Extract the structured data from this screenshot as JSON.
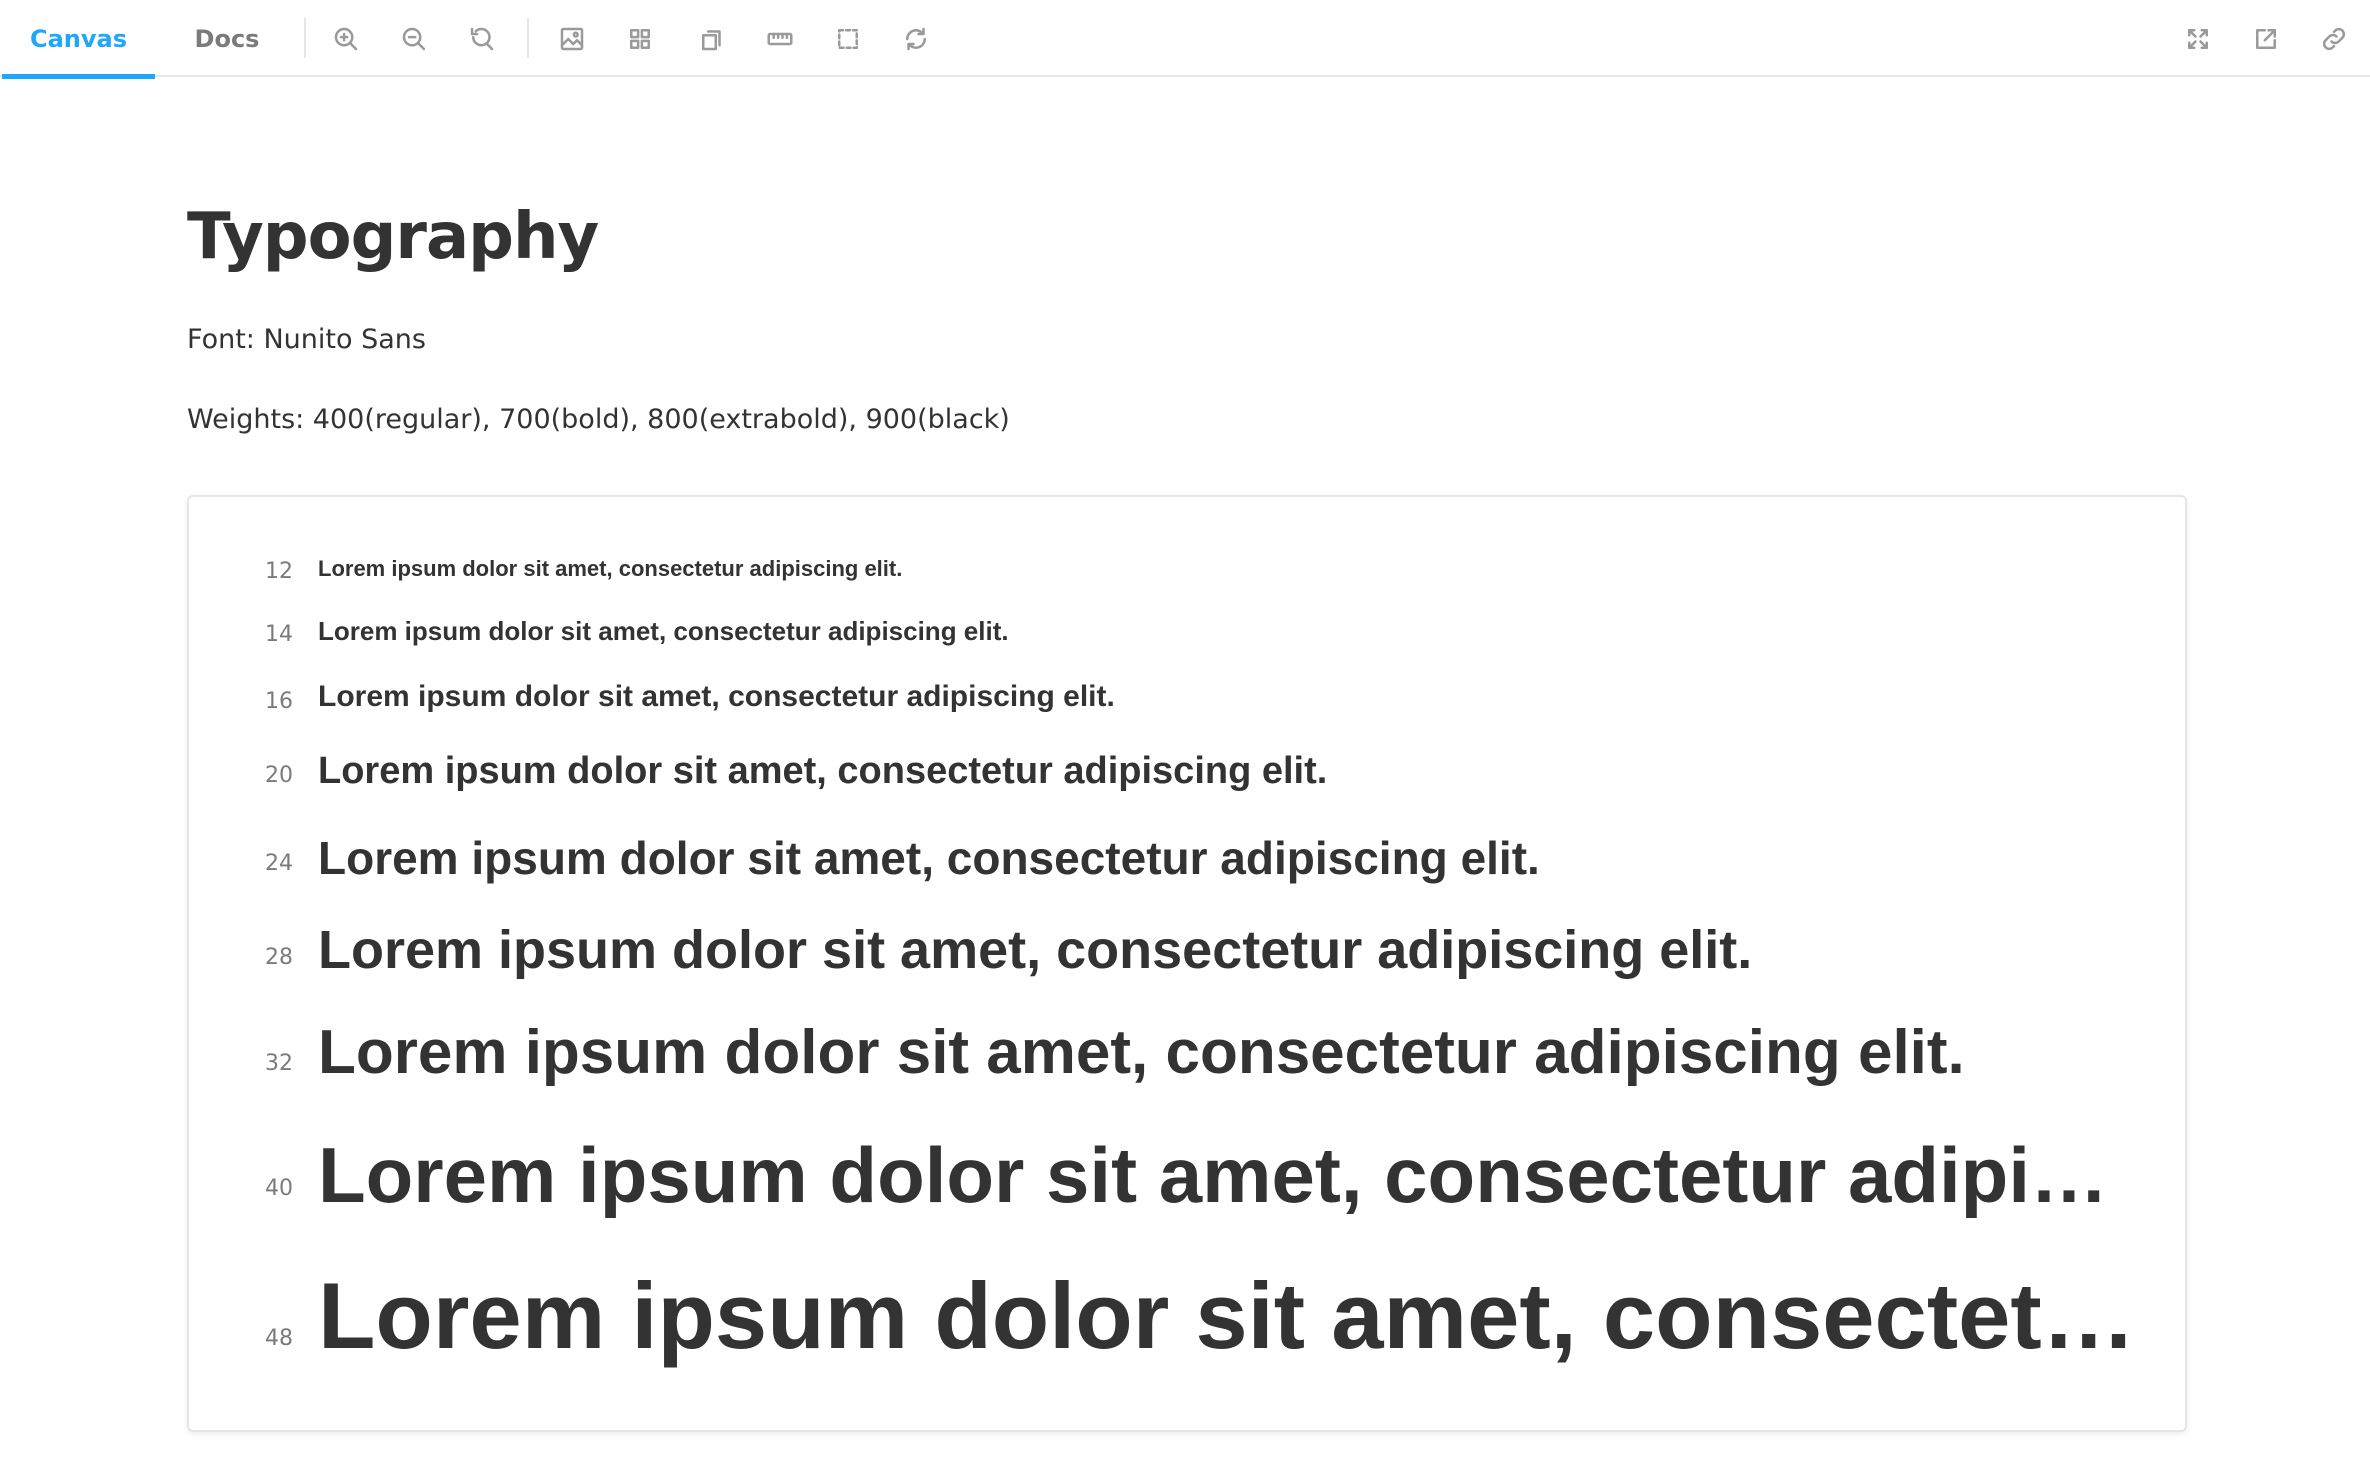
{
  "toolbar": {
    "tabs": [
      {
        "label": "Canvas",
        "active": true
      },
      {
        "label": "Docs",
        "active": false
      }
    ],
    "tools": [
      "zoom-in-icon",
      "zoom-out-icon",
      "reset-zoom-icon",
      "background-icon",
      "grid-icon",
      "viewport-icon",
      "measure-icon",
      "outline-icon",
      "remount-icon"
    ],
    "right_tools": [
      "fullscreen-icon",
      "open-new-tab-icon",
      "copy-link-icon"
    ],
    "accent_color": "#1ea7fd"
  },
  "page": {
    "title": "Typography",
    "font_line": "Font: Nunito Sans",
    "weights_line": "Weights: 400(regular), 700(bold), 800(extrabold), 900(black)"
  },
  "samples": [
    {
      "size": "12",
      "text": "Lorem ipsum dolor sit amet, consectetur adipiscing elit."
    },
    {
      "size": "14",
      "text": "Lorem ipsum dolor sit amet, consectetur adipiscing elit."
    },
    {
      "size": "16",
      "text": "Lorem ipsum dolor sit amet, consectetur adipiscing elit."
    },
    {
      "size": "20",
      "text": "Lorem ipsum dolor sit amet, consectetur adipiscing elit."
    },
    {
      "size": "24",
      "text": "Lorem ipsum dolor sit amet, consectetur adipiscing elit."
    },
    {
      "size": "28",
      "text": "Lorem ipsum dolor sit amet, consectetur adipiscing elit."
    },
    {
      "size": "32",
      "text": "Lorem ipsum dolor sit amet, consectetur adipiscing elit."
    },
    {
      "size": "40",
      "text": "Lorem ipsum dolor sit amet, consectetur adipiscing elit."
    },
    {
      "size": "48",
      "text": "Lorem ipsum dolor sit amet, consectetur adipiscing elit."
    }
  ]
}
